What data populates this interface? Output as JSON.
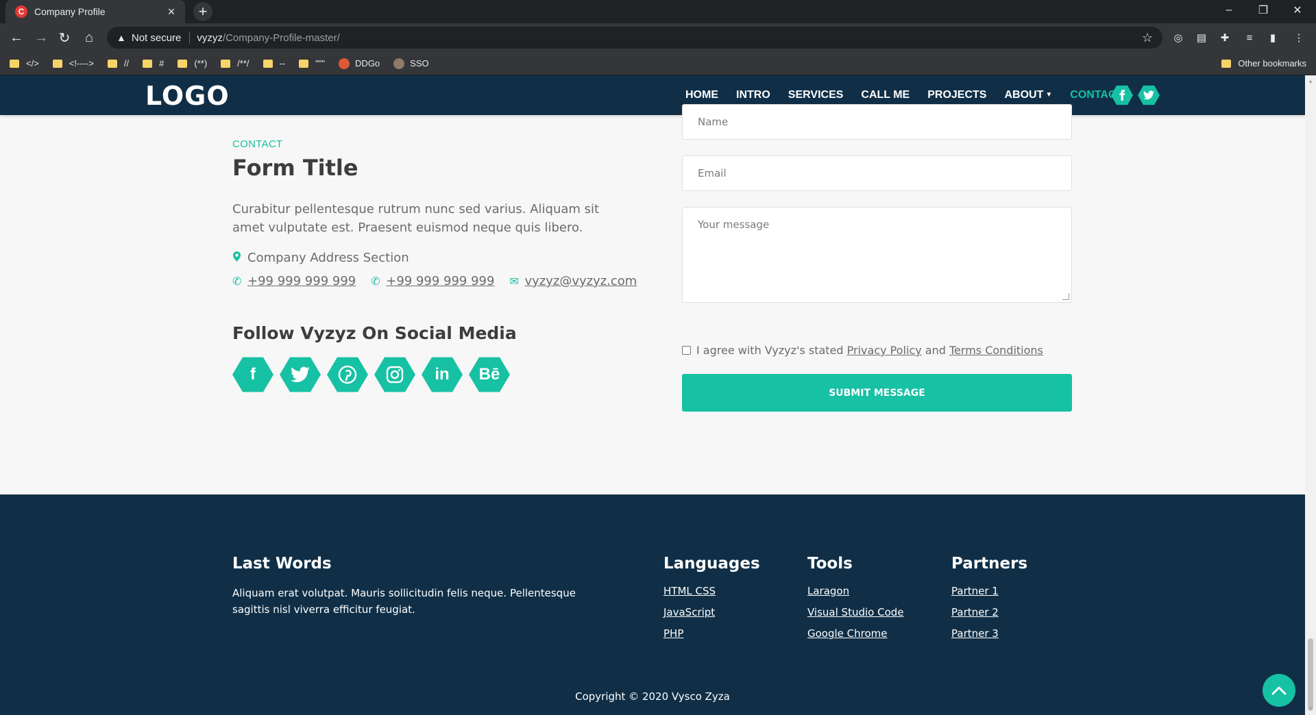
{
  "browser": {
    "tab_title": "Company Profile",
    "tab_favicon_letter": "C",
    "new_tab": "+",
    "security": "Not secure",
    "url_host": "vyzyz",
    "url_path": "/Company-Profile-master/",
    "bookmarks": [
      {
        "label": "</>",
        "icon": "folder-icon"
      },
      {
        "label": "<!---->",
        "icon": "folder-icon"
      },
      {
        "label": "//",
        "icon": "folder-icon"
      },
      {
        "label": "#",
        "icon": "folder-icon"
      },
      {
        "label": "(**)",
        "icon": "folder-icon"
      },
      {
        "label": "/**/",
        "icon": "folder-icon"
      },
      {
        "label": "--",
        "icon": "folder-icon"
      },
      {
        "label": "\"\"\"",
        "icon": "folder-icon"
      },
      {
        "label": "DDGo",
        "icon": "duckduckgo-icon"
      },
      {
        "label": "SSO",
        "icon": "sso-icon"
      }
    ],
    "other_bookmarks": "Other bookmarks"
  },
  "site": {
    "logo": "LOGO",
    "menu": {
      "home": "HOME",
      "intro": "INTRO",
      "services": "SERVICES",
      "call_me": "CALL ME",
      "projects": "PROJECTS",
      "about": "ABOUT",
      "contact": "CONTACT"
    },
    "accent_color": "#17c1a4",
    "nav_color": "#102f47"
  },
  "contact": {
    "eyebrow": "CONTACT",
    "title": "Form Title",
    "lead": "Curabitur pellentesque rutrum nunc sed varius. Aliquam sit amet vulputate est. Praesent euismod neque quis libero.",
    "address": "Company Address Section",
    "phone1": "+99 999 999 999",
    "phone2": "+99 999 999 999",
    "email": "vyzyz@vyzyz.com",
    "follow_title": "Follow Vyzyz On Social Media",
    "social": {
      "facebook": "f",
      "linkedin": "in",
      "behance": "Bē"
    }
  },
  "form": {
    "name_placeholder": "Name",
    "email_placeholder": "Email",
    "message_placeholder": "Your message",
    "agree_prefix": "I agree with Vyzyz's stated",
    "privacy": "Privacy Policy",
    "and": "and",
    "terms": "Terms Conditions",
    "submit": "SUBMIT MESSAGE"
  },
  "footer": {
    "last_words_title": "Last Words",
    "last_words_text": "Aliquam erat volutpat. Mauris sollicitudin felis neque. Pellentesque sagittis nisl viverra efficitur feugiat.",
    "languages": {
      "title": "Languages",
      "items": [
        "HTML CSS",
        "JavaScript",
        "PHP"
      ]
    },
    "tools": {
      "title": "Tools",
      "items": [
        "Laragon",
        "Visual Studio Code",
        "Google Chrome"
      ]
    },
    "partners": {
      "title": "Partners",
      "items": [
        "Partner 1",
        "Partner 2",
        "Partner 3"
      ]
    },
    "copyright": "Copyright © 2020 Vysco Zyza"
  }
}
